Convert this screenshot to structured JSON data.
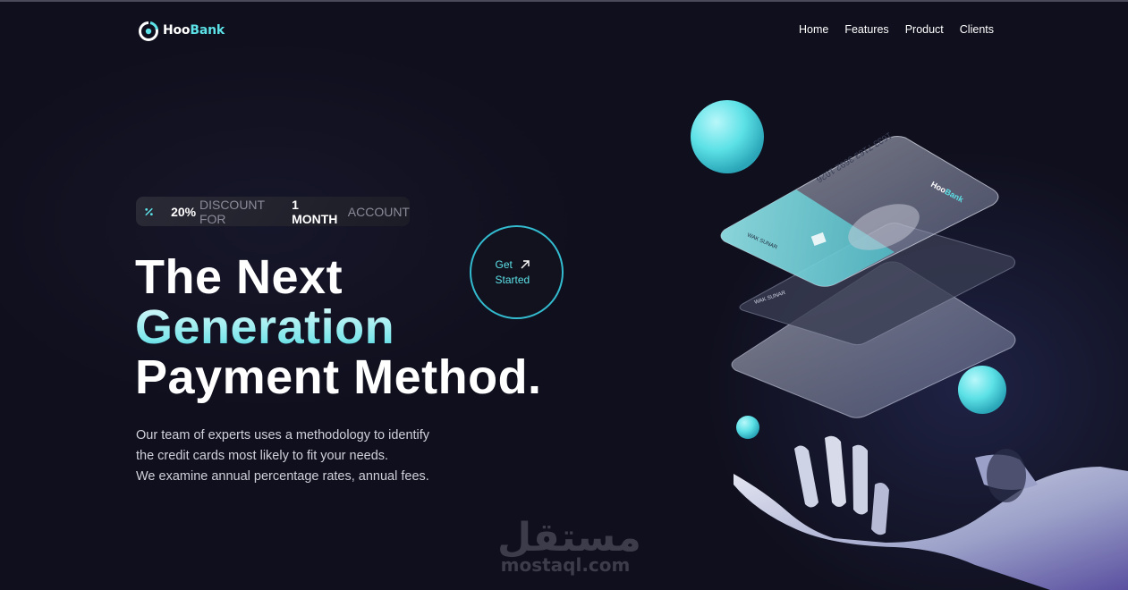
{
  "brand": {
    "name_part1": "Hoo",
    "name_part2": "Bank",
    "accent": "#5ce1e6"
  },
  "nav": {
    "items": [
      "Home",
      "Features",
      "Product",
      "Clients"
    ]
  },
  "badge": {
    "percent": "20%",
    "text1": "DISCOUNT FOR",
    "months": "1 MONTH",
    "text2": "ACCOUNT",
    "icon": "discount-icon"
  },
  "hero": {
    "line1": "The Next",
    "line2": "Generation",
    "line3": "Payment Method.",
    "cta_line1": "Get",
    "cta_line2": "Started",
    "cta_icon": "arrow-up-right-icon",
    "desc_line1": "Our team of experts uses a methodology to identify",
    "desc_line2": "the credit cards most likely to fit your needs.",
    "desc_line3": "We examine annual percentage rates, annual fees."
  },
  "card": {
    "number": "1633 7163 3692 1026",
    "holder": "WAK SUNAR",
    "brand_part1": "Hoo",
    "brand_part2": "Bank"
  },
  "watermark": {
    "arabic": "مستقل",
    "latin": "mostaql.com"
  }
}
